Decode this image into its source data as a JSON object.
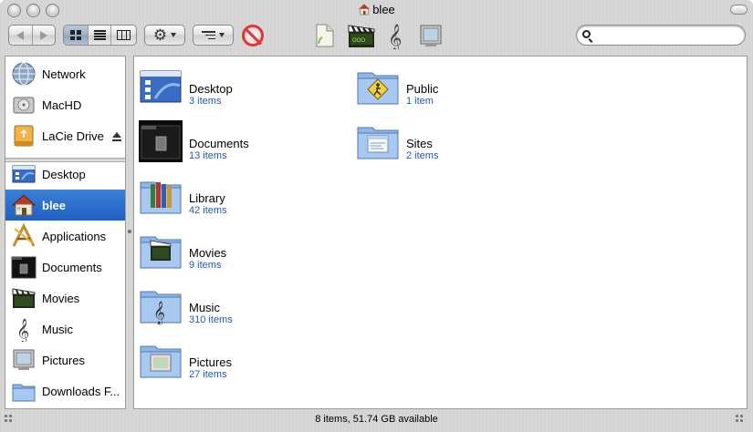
{
  "window": {
    "title": "blee"
  },
  "toolbar": {
    "back_icon": "back-arrow-icon",
    "forward_icon": "forward-arrow-icon",
    "view_icons": [
      "icon-view-icon",
      "list-view-icon",
      "column-view-icon"
    ],
    "active_view": "icon-view",
    "action_icon": "gear-icon",
    "arrange_icon": "arrange-icon",
    "burn_icon": "no-entry-icon",
    "shortcut_icons": [
      "document-icon",
      "movie-clapper-icon",
      "music-clef-icon",
      "picture-frame-icon"
    ],
    "search_placeholder": ""
  },
  "sidebar": {
    "devices": [
      {
        "label": "Network",
        "icon": "network-globe-icon"
      },
      {
        "label": "MacHD",
        "icon": "hard-drive-icon"
      },
      {
        "label": "LaCie Drive",
        "icon": "usb-drive-icon",
        "ejectable": true
      }
    ],
    "places": [
      {
        "label": "Desktop",
        "icon": "desktop-icon"
      },
      {
        "label": "blee",
        "icon": "home-icon",
        "selected": true
      },
      {
        "label": "Applications",
        "icon": "applications-icon"
      },
      {
        "label": "Documents",
        "icon": "documents-icon"
      },
      {
        "label": "Movies",
        "icon": "movies-icon"
      },
      {
        "label": "Music",
        "icon": "music-icon"
      },
      {
        "label": "Pictures",
        "icon": "pictures-icon"
      },
      {
        "label": "Downloads F...",
        "icon": "downloads-folder-icon"
      }
    ]
  },
  "content": {
    "items": [
      {
        "name": "Desktop",
        "count": "3 items",
        "icon": "desktop-folder-icon"
      },
      {
        "name": "Documents",
        "count": "13 items",
        "icon": "documents-folder-icon"
      },
      {
        "name": "Library",
        "count": "42 items",
        "icon": "library-folder-icon"
      },
      {
        "name": "Movies",
        "count": "9 items",
        "icon": "movies-folder-icon"
      },
      {
        "name": "Music",
        "count": "310 items",
        "icon": "music-folder-icon"
      },
      {
        "name": "Pictures",
        "count": "27 items",
        "icon": "pictures-folder-icon"
      },
      {
        "name": "Public",
        "count": "1 item",
        "icon": "public-folder-icon"
      },
      {
        "name": "Sites",
        "count": "2 items",
        "icon": "sites-folder-icon"
      }
    ]
  },
  "status": {
    "text": "8 items, 51.74 GB available"
  },
  "colors": {
    "selection": "#1f5fc1",
    "item_count": "#2458b3",
    "folder_blue": "#8eb6e6"
  }
}
